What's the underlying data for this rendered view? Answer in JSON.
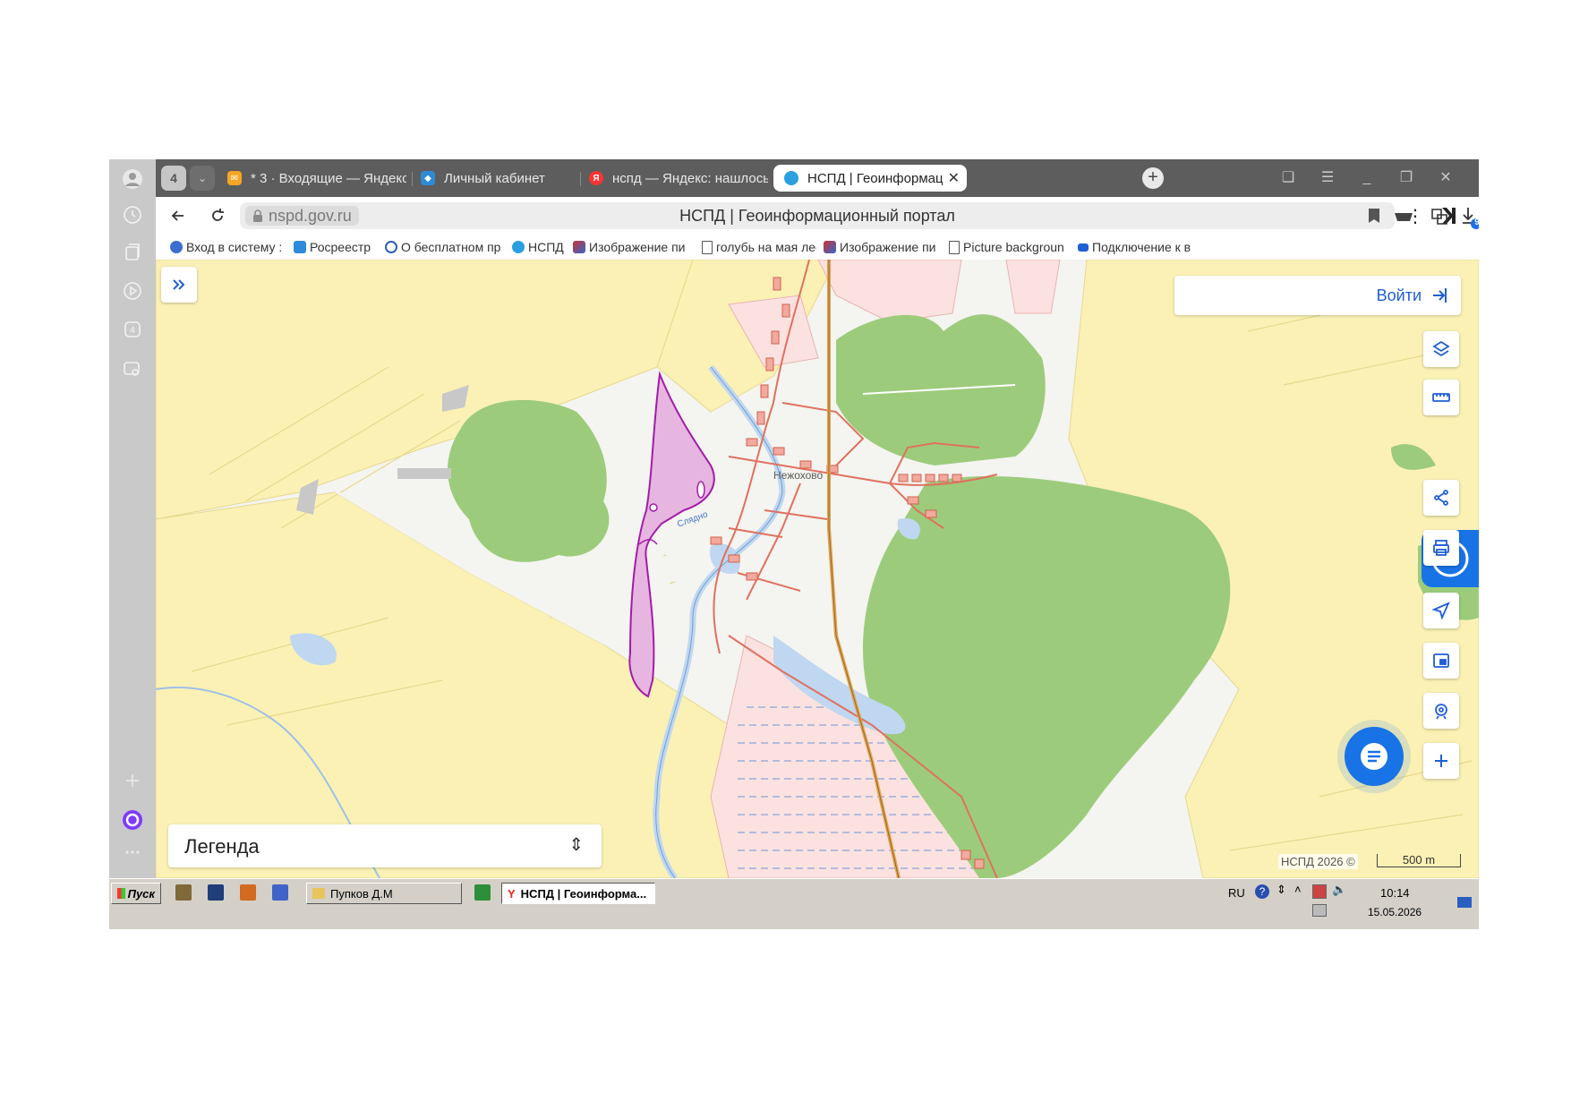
{
  "browser": {
    "tab_count": "4",
    "tabs": [
      {
        "label": "* 3 · Входящие — Яндекс",
        "icon": "mail-icon",
        "color": "#f5a623"
      },
      {
        "label": "Личный кабинет",
        "icon": "rosreestr-icon",
        "color": "#2e8bd8"
      },
      {
        "label": "нспд — Яндекс: нашлось",
        "icon": "yandex-icon",
        "color": "#f33"
      },
      {
        "label": "НСПД | Геоинформаци",
        "icon": "nspd-icon",
        "color": "#2aa0e0"
      }
    ],
    "address": {
      "url": "nspd.gov.ru",
      "page_title": "НСПД | Геоинформационный портал"
    },
    "bookmarks": [
      {
        "label": "Вход в систему ::",
        "icon": "gosuslugi-icon"
      },
      {
        "label": "Росреестр",
        "icon": "rosreestr-icon"
      },
      {
        "label": "О бесплатном пр",
        "icon": "c-icon"
      },
      {
        "label": "НСПД",
        "icon": "nspd-icon"
      },
      {
        "label": "Изображение пи",
        "icon": "image-icon"
      },
      {
        "label": "голубь на мая лес",
        "icon": "doc-icon"
      },
      {
        "label": "Изображение пи",
        "icon": "image-icon"
      },
      {
        "label": "Picture backgroun",
        "icon": "doc-icon"
      },
      {
        "label": "Подключение к в",
        "icon": "video-icon"
      }
    ],
    "download_badge": "9"
  },
  "map": {
    "login_label": "Войти",
    "legend_label": "Легенда",
    "copyright": "НСПД 2026 ©",
    "scale_label": "500 m",
    "river_label": "Сляднo",
    "village_label": "Нежохово",
    "parcel_color": "#e7b6e0",
    "parcel_border": "#a21ca8",
    "forest_color": "#9ccc7b",
    "field_color": "#fbf1b5"
  },
  "taskbar": {
    "start_label": "Пуск",
    "folder_label": "Пупков Д.М",
    "active_label": "НСПД | Геоинформа...",
    "lang": "RU",
    "time": "10:14",
    "date": "15.05.2026"
  }
}
